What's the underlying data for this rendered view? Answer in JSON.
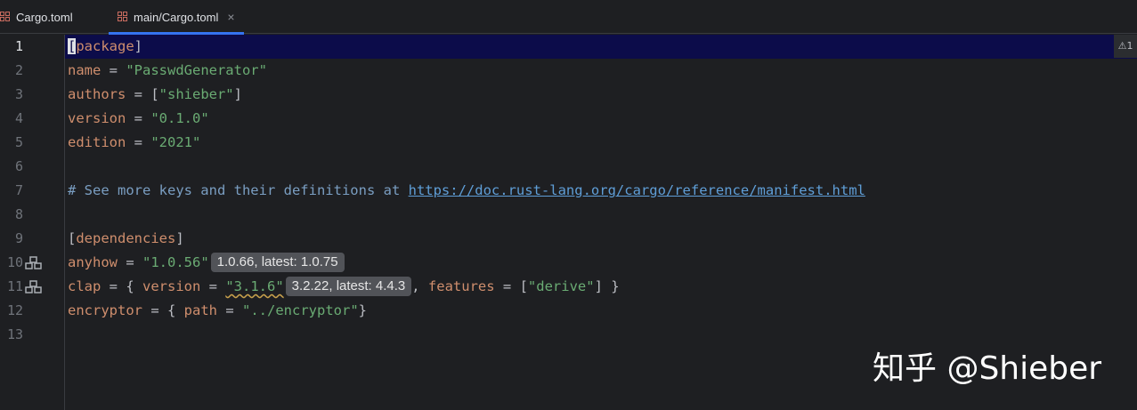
{
  "tabs": [
    {
      "label": "Cargo.toml",
      "active": false
    },
    {
      "label": "main/Cargo.toml",
      "active": true,
      "close": "×"
    }
  ],
  "editor": {
    "warning_count": "1",
    "lines": [
      {
        "num": "1"
      },
      {
        "num": "2"
      },
      {
        "num": "3"
      },
      {
        "num": "4"
      },
      {
        "num": "5"
      },
      {
        "num": "6"
      },
      {
        "num": "7"
      },
      {
        "num": "8"
      },
      {
        "num": "9"
      },
      {
        "num": "10"
      },
      {
        "num": "11"
      },
      {
        "num": "12"
      },
      {
        "num": "13"
      }
    ],
    "code": {
      "l1_open": "[",
      "l1_section": "package",
      "l1_close": "]",
      "l2_key": "name",
      "l2_eq": " = ",
      "l2_val": "\"PasswdGenerator\"",
      "l3_key": "authors",
      "l3_eq": " = [",
      "l3_val": "\"shieber\"",
      "l3_end": "]",
      "l4_key": "version",
      "l4_eq": " = ",
      "l4_val": "\"0.1.0\"",
      "l5_key": "edition",
      "l5_eq": " = ",
      "l5_val": "\"2021\"",
      "l7_comment": "# See more keys and their definitions at ",
      "l7_url": "https://doc.rust-lang.org/cargo/reference/manifest.html",
      "l9_open": "[",
      "l9_section": "dependencies",
      "l9_close": "]",
      "l10_key": "anyhow",
      "l10_eq": " = ",
      "l10_val": "\"1.0.56\"",
      "l10_hint": "1.0.66, latest: 1.0.75",
      "l11_key": "clap",
      "l11_eq": " = { ",
      "l11_vkey": "version",
      "l11_veq": " = ",
      "l11_val": "\"3.1.6\"",
      "l11_hint": "3.2.22, latest: 4.4.3",
      "l11_sep": ", ",
      "l11_fkey": "features",
      "l11_feq": " = [",
      "l11_fval": "\"derive\"",
      "l11_end": "] }",
      "l12_key": "encryptor",
      "l12_eq": " = { ",
      "l12_pkey": "path",
      "l12_peq": " = ",
      "l12_pval": "\"../encryptor\"",
      "l12_end": "}"
    }
  },
  "watermark": "知乎 @Shieber",
  "colors": {
    "background": "#1e1f22",
    "current_line": "#0c0c4a",
    "keyword": "#cf8e6d",
    "string": "#6aab73",
    "comment": "#7a9ec2",
    "link": "#5f9ed7",
    "tab_underline": "#3574f0"
  },
  "icons": [
    "cargo-file-icon",
    "crate-dependency-icon",
    "warning-icon"
  ]
}
